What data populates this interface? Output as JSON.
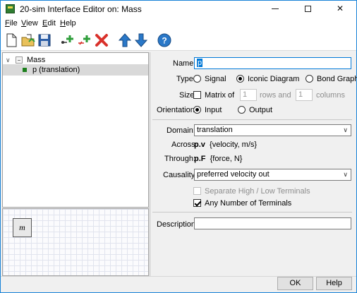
{
  "window": {
    "title": "20-sim Interface Editor on: Mass"
  },
  "menu": {
    "items": [
      {
        "label": "File",
        "accel": "F",
        "rest": "ile"
      },
      {
        "label": "View",
        "accel": "V",
        "rest": "iew"
      },
      {
        "label": "Edit",
        "accel": "E",
        "rest": "dit"
      },
      {
        "label": "Help",
        "accel": "H",
        "rest": "elp"
      }
    ]
  },
  "toolbar": {
    "icons": [
      "new-document-icon",
      "open-folder-icon",
      "save-disk-icon",
      "add-port-icon",
      "insert-port-icon",
      "delete-icon",
      "move-up-icon",
      "move-down-icon",
      "help-icon"
    ],
    "colors": {
      "green": "#2e9e3a",
      "red": "#d9312b",
      "blue": "#2a78c8"
    }
  },
  "tree": {
    "root": "Mass",
    "children": [
      "p  (translation)"
    ]
  },
  "graphic": {
    "symbol": "m"
  },
  "form": {
    "name_label": "Name:",
    "name_value": "p",
    "type_label": "Type:",
    "type_options": [
      "Signal",
      "Iconic Diagram",
      "Bond Graph"
    ],
    "type_selected": "Iconic Diagram",
    "size_label": "Size:",
    "matrix_label": "Matrix of",
    "rows_value": "1",
    "rows_label": "rows and",
    "cols_value": "1",
    "cols_label": "columns",
    "orientation_label": "Orientation:",
    "orientation_options": [
      "Input",
      "Output"
    ],
    "orientation_selected": "Input",
    "domain_label": "Domain:",
    "domain_value": "translation",
    "across_label": "Across:",
    "across_var": "p.v",
    "across_desc": "{velocity, m/s}",
    "through_label": "Through:",
    "through_var": "p.F",
    "through_desc": "{force, N}",
    "causality_label": "Causality:",
    "causality_value": "preferred velocity out",
    "separate_terminals_label": "Separate High / Low Terminals",
    "any_terminals_label": "Any Number of Terminals",
    "description_label": "Description:",
    "description_value": ""
  },
  "buttons": {
    "ok": "OK",
    "help": "Help"
  },
  "colors": {
    "accent": "#0078d7",
    "selection_bg": "#d9d9d9"
  }
}
